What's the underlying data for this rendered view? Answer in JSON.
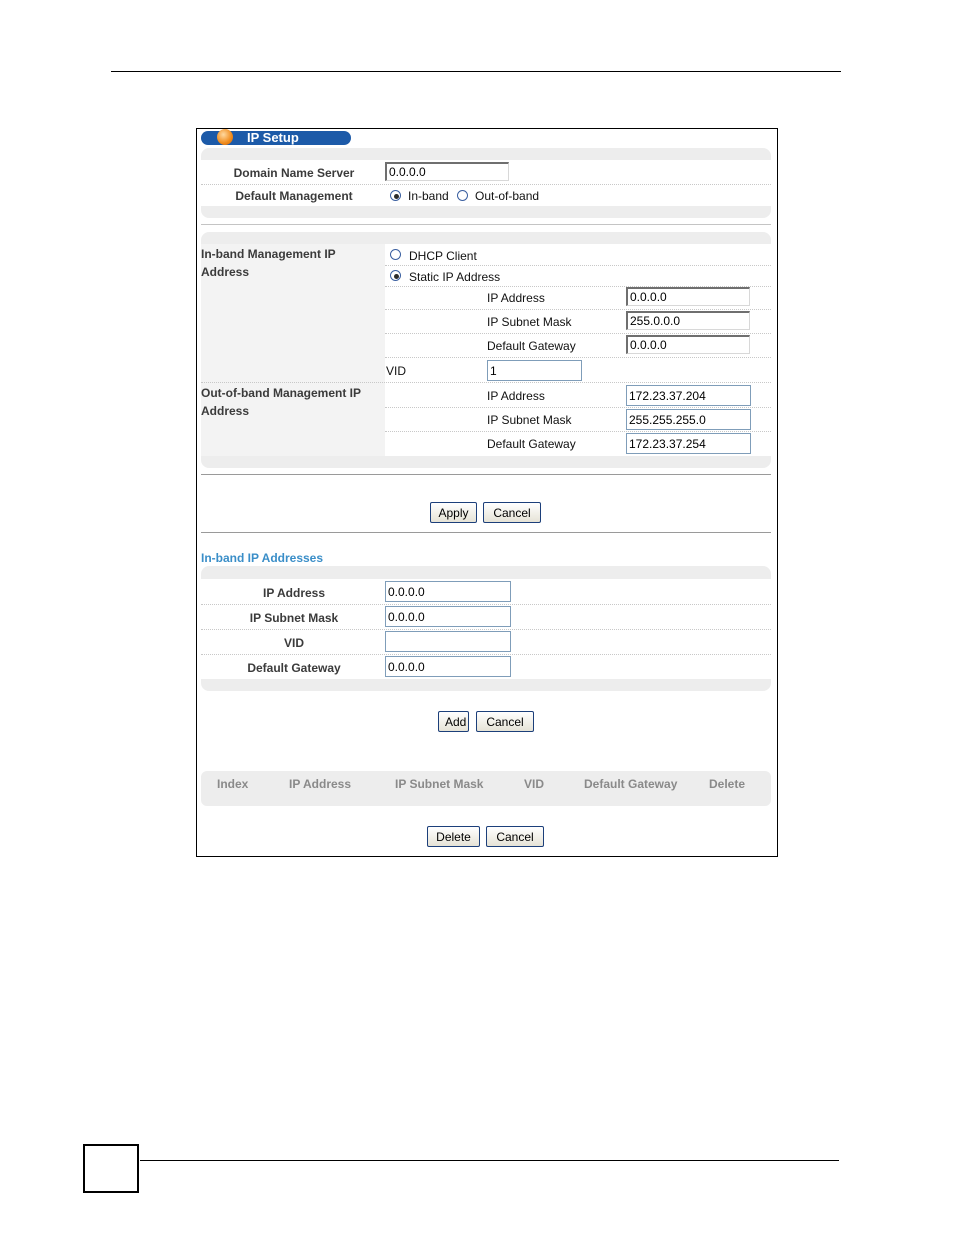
{
  "window": {
    "title": "IP Setup"
  },
  "general": {
    "dns_label": "Domain Name Server",
    "dns_value": "0.0.0.0",
    "mgmt_label": "Default Management",
    "opt_inband": "In-band",
    "opt_outband": "Out-of-band"
  },
  "inband_mgmt": {
    "label_line1": "In-band Management IP",
    "label_line2": "Address",
    "opt_dhcp": "DHCP Client",
    "opt_static": "Static IP Address",
    "ip_label": "IP Address",
    "ip_value": "0.0.0.0",
    "mask_label": "IP Subnet Mask",
    "mask_value": "255.0.0.0",
    "gw_label": "Default Gateway",
    "gw_value": "0.0.0.0",
    "vid_label": "VID",
    "vid_value": "1"
  },
  "outband_mgmt": {
    "label_line1": "Out-of-band Management IP",
    "label_line2": "Address",
    "ip_label": "IP Address",
    "ip_value": "172.23.37.204",
    "mask_label": "IP Subnet Mask",
    "mask_value": "255.255.255.0",
    "gw_label": "Default Gateway",
    "gw_value": "172.23.37.254"
  },
  "actions1": {
    "apply": "Apply",
    "cancel": "Cancel"
  },
  "inband_addresses": {
    "title": "In-band IP Addresses",
    "ip_label": "IP Address",
    "ip_value": "0.0.0.0",
    "mask_label": "IP Subnet Mask",
    "mask_value": "0.0.0.0",
    "vid_label": "VID",
    "vid_value": "",
    "gw_label": "Default Gateway",
    "gw_value": "0.0.0.0"
  },
  "actions2": {
    "add": "Add",
    "cancel": "Cancel"
  },
  "table": {
    "headers": [
      "Index",
      "IP Address",
      "IP Subnet Mask",
      "VID",
      "Default Gateway",
      "Delete"
    ]
  },
  "actions3": {
    "delete": "Delete",
    "cancel": "Cancel"
  }
}
